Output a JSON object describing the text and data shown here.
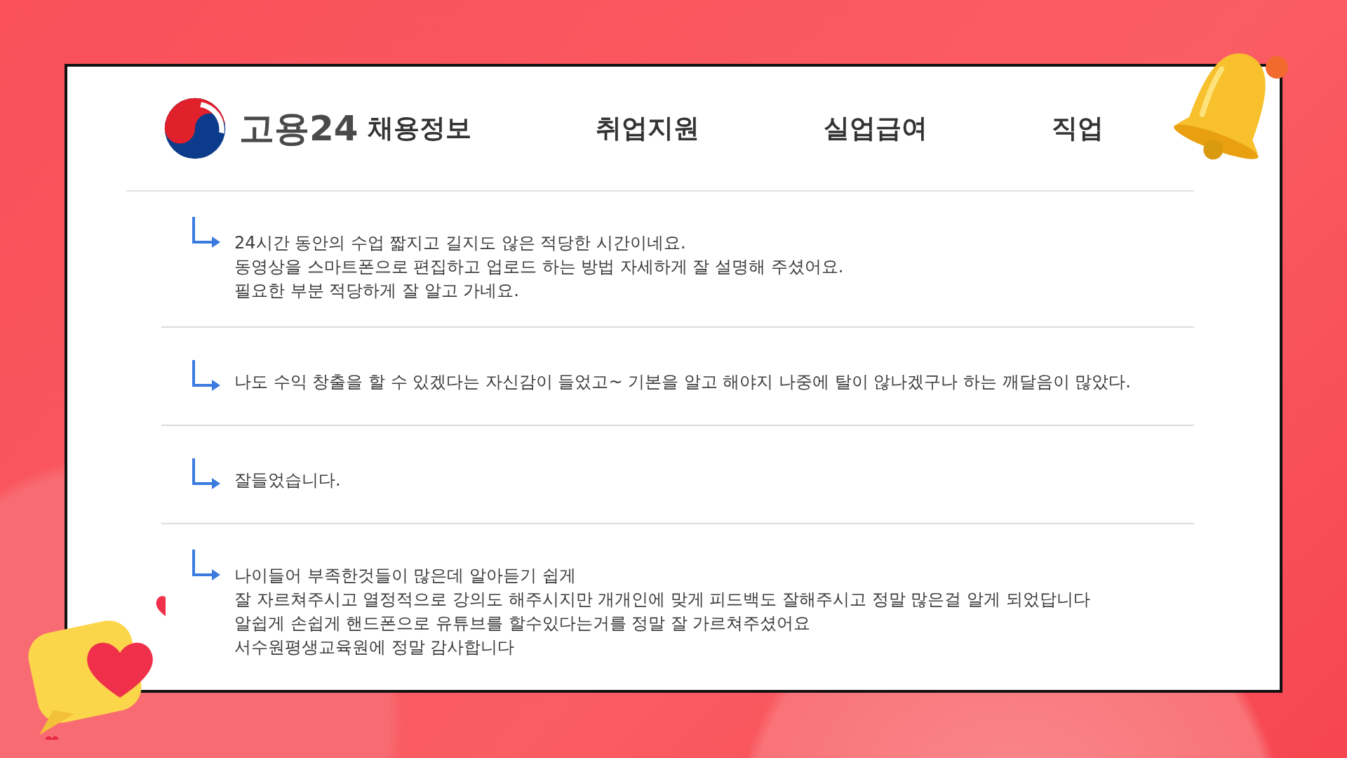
{
  "header": {
    "logo_text": "고용24",
    "nav": [
      {
        "label": "채용정보"
      },
      {
        "label": "취업지원"
      },
      {
        "label": "실업급여"
      },
      {
        "label": "직업"
      }
    ]
  },
  "reviews": [
    {
      "lines": [
        "24시간 동안의 수업 짧지고 길지도 않은 적당한 시간이네요.",
        "동영상을 스마트폰으로 편집하고 업로드 하는 방법 자세하게 잘 설명해 주셨어요.",
        "필요한 부분 적당하게 잘 알고 가네요."
      ]
    },
    {
      "lines": [
        "나도 수익 창출을 할 수 있겠다는 자신감이 들었고~ 기본을 알고 해야지 나중에 탈이 않나겠구나 하는 깨달음이 많았다."
      ]
    },
    {
      "lines": [
        "잘들었습니다."
      ]
    },
    {
      "lines": [
        "나이들어 부족한것들이 많은데 알아듣기 쉽게",
        "잘 자르쳐주시고 열정적으로 강의도 해주시지만 개개인에 맞게 피드백도 잘해주시고 정말 많은걸 알게 되었답니다",
        "알쉽게 손쉽게 핸드폰으로 유튜브를 할수있다는거를 정말 잘 가르쳐주셨어요",
        "서수원평생교육원에 정말 감사합니다"
      ]
    }
  ]
}
